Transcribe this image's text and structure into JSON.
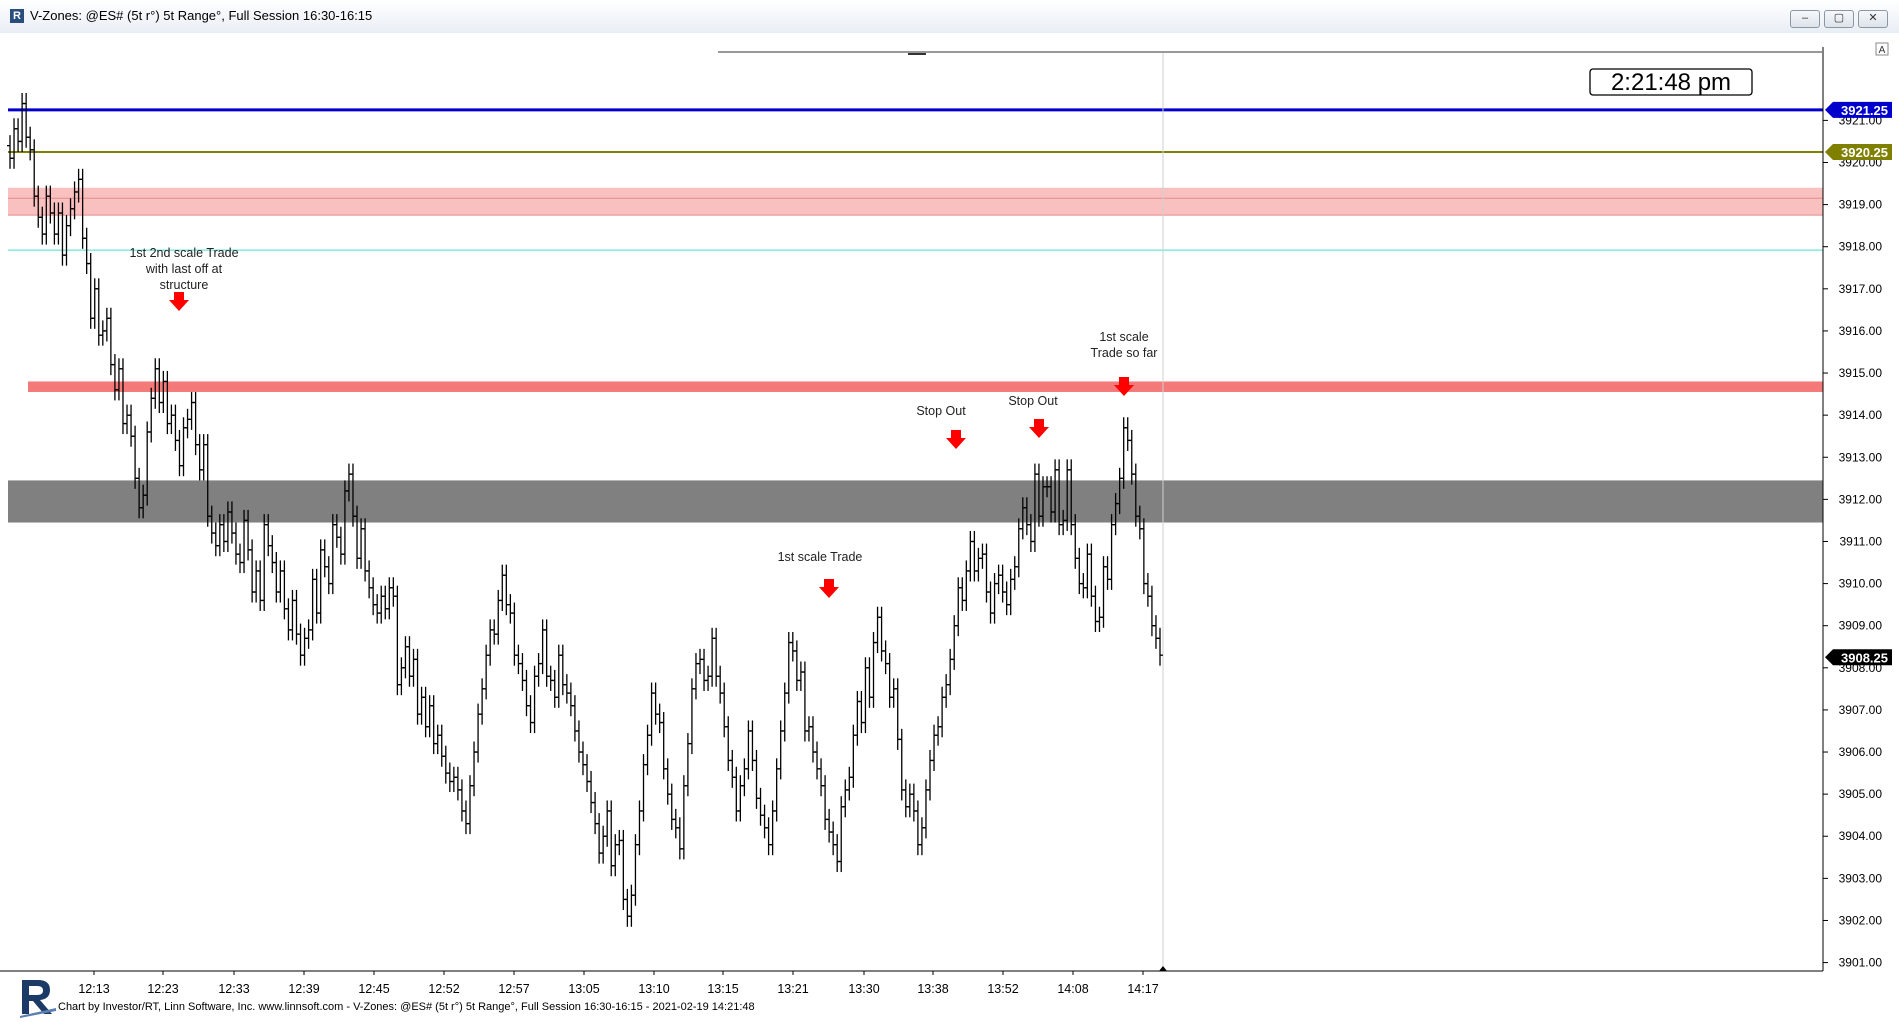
{
  "window": {
    "title": "V-Zones: @ES# (5t r°) 5t Range°, Full Session 16:30-16:15",
    "buttons": [
      "–",
      "▢",
      "✕"
    ]
  },
  "clock": "2:21:48 pm",
  "footer": {
    "credit": "Chart by Investor/RT, Linn Software, Inc. www.linnsoft.com - V-Zones: @ES# (5t r°) 5t Range°, Full Session 16:30-16:15 - 2021-02-19 14:21:48"
  },
  "chart_data": {
    "type": "ohlc",
    "x_tick_labels": [
      "12:13",
      "12:23",
      "12:33",
      "12:39",
      "12:45",
      "12:52",
      "12:57",
      "13:05",
      "13:10",
      "13:15",
      "13:21",
      "13:30",
      "13:38",
      "13:52",
      "14:08",
      "14:17"
    ],
    "y_tick_labels": [
      "3901.00",
      "3902.00",
      "3903.00",
      "3904.00",
      "3905.00",
      "3906.00",
      "3907.00",
      "3908.00",
      "3909.00",
      "3910.00",
      "3911.00",
      "3912.00",
      "3913.00",
      "3914.00",
      "3915.00",
      "3916.00",
      "3917.00",
      "3918.00",
      "3919.00",
      "3920.00",
      "3921.00"
    ],
    "ylim": [
      3900.8,
      3922.6
    ],
    "price_badges": [
      {
        "label": "3921.25",
        "value": 3921.25,
        "color": "#0000cc"
      },
      {
        "label": "3920.25",
        "value": 3920.25,
        "color": "#808000"
      },
      {
        "label": "3908.25",
        "value": 3908.25,
        "color": "#000000"
      }
    ],
    "levels": [
      {
        "value": 3921.25,
        "color": "#0000cc"
      },
      {
        "value": 3920.25,
        "color": "#808000"
      },
      {
        "value": 3917.92,
        "color": "#40e0d0"
      }
    ],
    "zones": [
      {
        "from": 3918.75,
        "to": 3919.4,
        "color": "#f9c0c0"
      },
      {
        "from": 3914.55,
        "to": 3914.8,
        "color": "#f47a7a"
      },
      {
        "from": 3911.45,
        "to": 3912.45,
        "color": "#808080"
      }
    ],
    "series": [
      {
        "name": "",
        "close": [
          3920.1,
          3920.8,
          3920.5,
          3921.4,
          3920.6,
          3920.3,
          3919.2,
          3918.7,
          3918.3,
          3919.2,
          3918.8,
          3918.3,
          3918.8,
          3917.8,
          3918.5,
          3918.9,
          3919.3,
          3919.6,
          3918.2,
          3917.6,
          3916.3,
          3917.0,
          3915.9,
          3916.0,
          3916.3,
          3915.2,
          3914.6,
          3915.1,
          3913.8,
          3914.0,
          3913.5,
          3912.5,
          3911.8,
          3912.1,
          3913.6,
          3914.4,
          3915.1,
          3914.3,
          3914.8,
          3913.8,
          3914.0,
          3913.4,
          3912.8,
          3913.7,
          3913.9,
          3914.3,
          3913.3,
          3912.7,
          3913.3,
          3911.6,
          3911.2,
          3910.9,
          3911.4,
          3911.0,
          3911.7,
          3911.2,
          3910.7,
          3910.5,
          3911.5,
          3910.8,
          3909.8,
          3910.3,
          3909.6,
          3911.4,
          3910.9,
          3910.5,
          3909.8,
          3910.3,
          3909.4,
          3908.9,
          3909.6,
          3908.8,
          3908.3,
          3908.7,
          3908.9,
          3910.1,
          3909.3,
          3910.8,
          3910.4,
          3910.0,
          3911.4,
          3911.1,
          3910.7,
          3912.2,
          3912.6,
          3911.6,
          3910.6,
          3911.3,
          3910.3,
          3909.9,
          3909.5,
          3909.3,
          3909.7,
          3909.4,
          3909.9,
          3909.7,
          3907.6,
          3908.0,
          3908.5,
          3907.8,
          3908.2,
          3906.9,
          3907.3,
          3906.6,
          3907.1,
          3906.2,
          3906.4,
          3905.9,
          3905.5,
          3905.3,
          3905.4,
          3905.1,
          3904.6,
          3904.3,
          3905.2,
          3906.0,
          3906.9,
          3907.5,
          3908.3,
          3908.9,
          3908.8,
          3909.6,
          3910.2,
          3909.5,
          3909.3,
          3908.3,
          3908.1,
          3907.7,
          3907.1,
          3906.7,
          3907.8,
          3908.1,
          3908.9,
          3907.8,
          3907.7,
          3907.3,
          3908.3,
          3907.6,
          3907.4,
          3907.1,
          3906.5,
          3906.0,
          3905.7,
          3905.3,
          3904.8,
          3904.3,
          3903.6,
          3904.0,
          3904.6,
          3903.3,
          3903.8,
          3903.9,
          3902.5,
          3902.1,
          3902.6,
          3903.8,
          3904.6,
          3905.7,
          3906.4,
          3907.4,
          3906.9,
          3906.7,
          3905.6,
          3905.0,
          3904.4,
          3904.2,
          3903.7,
          3905.2,
          3906.2,
          3907.5,
          3908.1,
          3908.2,
          3907.7,
          3907.8,
          3908.7,
          3907.8,
          3907.4,
          3906.6,
          3905.8,
          3905.4,
          3904.6,
          3905.2,
          3905.6,
          3906.5,
          3905.8,
          3904.9,
          3904.5,
          3904.2,
          3903.8,
          3904.6,
          3905.6,
          3906.5,
          3907.4,
          3908.6,
          3908.4,
          3907.7,
          3907.9,
          3906.5,
          3906.6,
          3906.0,
          3905.6,
          3905.2,
          3904.4,
          3904.1,
          3903.8,
          3903.4,
          3904.7,
          3905.1,
          3905.4,
          3906.4,
          3907.2,
          3906.7,
          3908.0,
          3907.3,
          3908.6,
          3909.2,
          3908.4,
          3908.1,
          3907.3,
          3907.5,
          3906.3,
          3905.1,
          3904.7,
          3905.0,
          3904.6,
          3903.8,
          3904.2,
          3905.1,
          3905.8,
          3906.4,
          3906.6,
          3907.3,
          3907.6,
          3908.2,
          3909.0,
          3909.9,
          3909.6,
          3910.3,
          3911.0,
          3910.3,
          3910.6,
          3910.7,
          3909.8,
          3909.3,
          3910.0,
          3910.2,
          3909.8,
          3909.5,
          3910.1,
          3910.4,
          3911.3,
          3911.8,
          3911.4,
          3911.0,
          3912.6,
          3911.6,
          3912.3,
          3912.3,
          3911.7,
          3912.7,
          3911.4,
          3911.5,
          3912.7,
          3911.4,
          3910.6,
          3910.0,
          3909.9,
          3910.7,
          3909.7,
          3909.1,
          3909.2,
          3910.4,
          3910.1,
          3911.4,
          3911.9,
          3912.5,
          3913.7,
          3913.4,
          3912.6,
          3911.6,
          3911.3,
          3910.0,
          3909.7,
          3909.0,
          3908.7,
          3908.3
        ]
      }
    ],
    "annotations": [
      {
        "label": "1st 2nd  scale Trade\nwith last off at\nstructure"
      },
      {
        "label": "1st scale Trade"
      },
      {
        "label": "Stop Out"
      },
      {
        "label": "Stop Out"
      },
      {
        "label": "1st scale\nTrade so far"
      }
    ]
  }
}
